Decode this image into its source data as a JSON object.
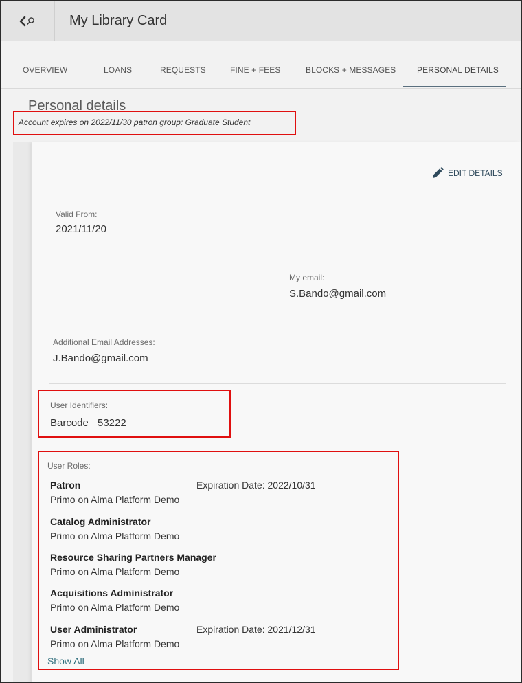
{
  "header": {
    "title": "My Library Card",
    "back_icon": "chevron-left-icon",
    "search_icon": "search-icon"
  },
  "tabs": [
    {
      "label": "OVERVIEW",
      "active": false
    },
    {
      "label": "LOANS",
      "active": false
    },
    {
      "label": "REQUESTS",
      "active": false
    },
    {
      "label": "FINE + FEES",
      "active": false
    },
    {
      "label": "BLOCKS + MESSAGES",
      "active": false
    },
    {
      "label": "PERSONAL DETAILS",
      "active": true
    }
  ],
  "personal": {
    "heading": "Personal details",
    "account_expiry": "Account expires on 2022/11/30 patron group: Graduate Student",
    "edit_label": "EDIT DETAILS",
    "edit_icon": "pencil-icon",
    "valid_from_label": "Valid From:",
    "valid_from_value": "2021/11/20",
    "email_label": "My email:",
    "email_value": "S.Bando@gmail.com",
    "additional_email_label": "Additional Email Addresses:",
    "additional_email_value": "J.Bando@gmail.com",
    "identifiers_label": "User Identifiers:",
    "identifier_type": "Barcode",
    "identifier_value": "53222",
    "roles_label": "User Roles:",
    "roles": [
      {
        "name": "Patron",
        "institution": "Primo on Alma Platform Demo",
        "expiration": "Expiration Date: 2022/10/31"
      },
      {
        "name": "Catalog Administrator",
        "institution": "Primo on Alma Platform Demo",
        "expiration": ""
      },
      {
        "name": "Resource Sharing Partners Manager",
        "institution": "Primo on Alma Platform Demo",
        "expiration": ""
      },
      {
        "name": "Acquisitions Administrator",
        "institution": "Primo on Alma Platform Demo",
        "expiration": ""
      },
      {
        "name": "User Administrator",
        "institution": "Primo on Alma Platform Demo",
        "expiration": "Expiration Date: 2021/12/31"
      }
    ],
    "show_all": "Show All"
  },
  "colors": {
    "highlight_box": "#e01010",
    "link": "#2b6b7a",
    "tab_underline": "#5a6f7e"
  }
}
